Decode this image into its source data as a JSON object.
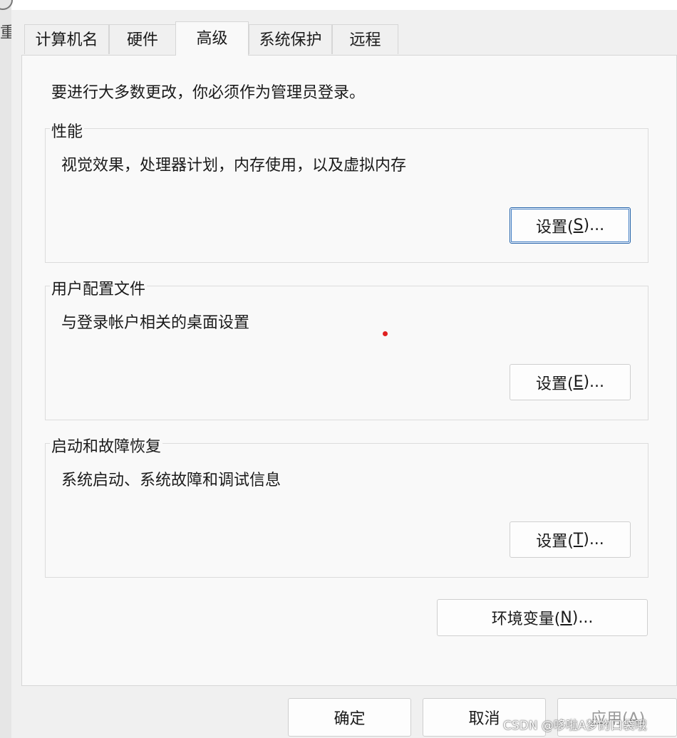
{
  "tabs": [
    {
      "label": "计算机名"
    },
    {
      "label": "硬件"
    },
    {
      "label": "高级"
    },
    {
      "label": "系统保护"
    },
    {
      "label": "远程"
    }
  ],
  "active_tab": "高级",
  "background_fragment": "重",
  "admin_note": "要进行大多数更改，你必须作为管理员登录。",
  "performance": {
    "title": "性能",
    "description": "视觉效果，处理器计划，内存使用，以及虚拟内存",
    "button_text": "设置(",
    "button_key": "S",
    "button_suffix": ")..."
  },
  "user_profiles": {
    "title": "用户配置文件",
    "description": "与登录帐户相关的桌面设置",
    "button_text": "设置(",
    "button_key": "E",
    "button_suffix": ")..."
  },
  "startup_recovery": {
    "title": "启动和故障恢复",
    "description": "系统启动、系统故障和调试信息",
    "button_text": "设置(",
    "button_key": "T",
    "button_suffix": ")..."
  },
  "env_button": {
    "text": "环境变量(",
    "key": "N",
    "suffix": ")..."
  },
  "footer": {
    "ok": "确定",
    "cancel": "取消",
    "apply": "应用(A)"
  },
  "watermark": "CSDN @哆啦A梦的口袋哦"
}
